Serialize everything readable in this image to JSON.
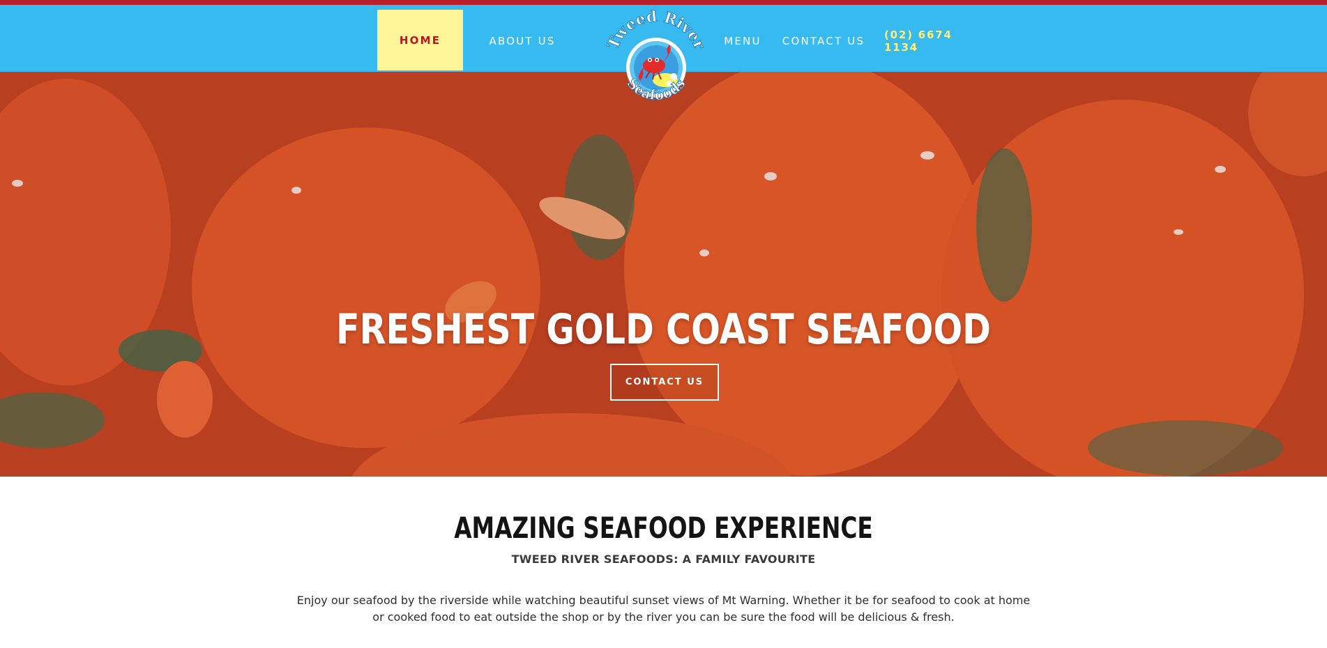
{
  "nav": {
    "home": "HOME",
    "about": "ABOUT US",
    "menu": "MENU",
    "contact": "CONTACT US",
    "phone": "(02) 6674 1134"
  },
  "logo": {
    "line1": "Tweed River",
    "line2": "Seafoods"
  },
  "hero": {
    "title": "FRESHEST GOLD COAST SEAFOOD",
    "button": "CONTACT US"
  },
  "intro": {
    "title": "AMAZING SEAFOOD EXPERIENCE",
    "subtitle": "TWEED RIVER SEAFOODS: A FAMILY FAVOURITE",
    "body": "Enjoy our seafood by the riverside while watching beautiful sunset views of Mt Warning. Whether it be for seafood to cook at home or cooked food to eat outside the shop or by the river you can be sure the food will be delicious & fresh."
  },
  "colors": {
    "nav_bg": "#37baf0",
    "top_stripe": "#b8202a",
    "active_tab_bg": "#fdf597",
    "active_tab_text": "#b81822",
    "phone_text": "#fff47a"
  }
}
